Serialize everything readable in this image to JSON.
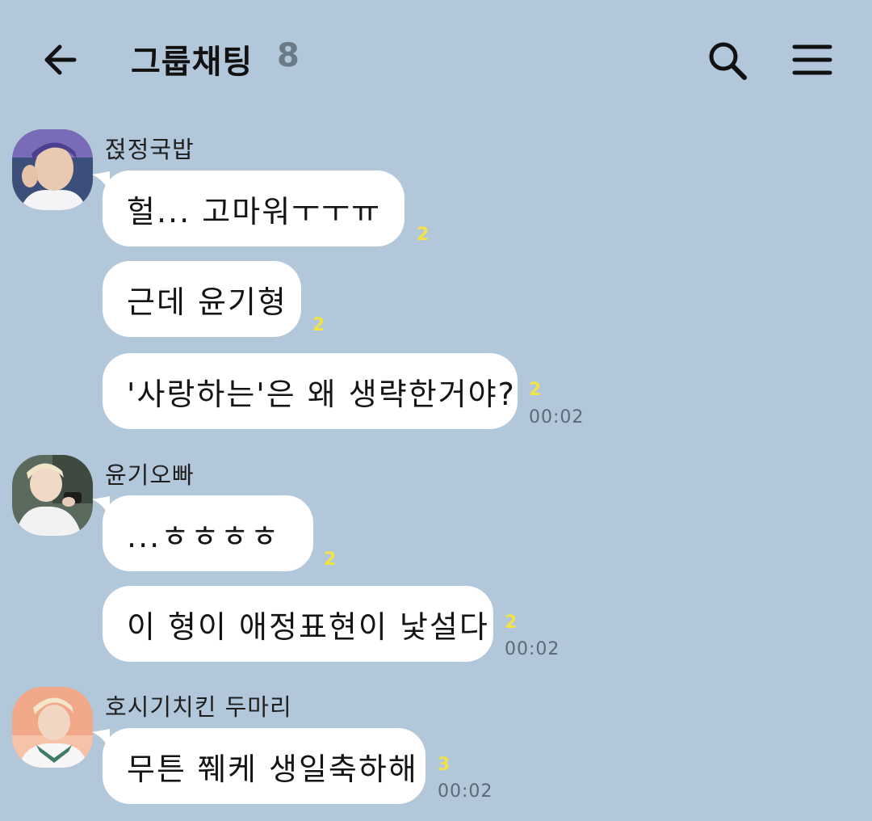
{
  "header": {
    "title": "그룹채팅",
    "member_count": "8"
  },
  "messages": [
    {
      "sender": "젅정국밥",
      "avatar": "avatar-jungkook",
      "lines": [
        {
          "text": "헐... 고마워ㅜㅜㅠ",
          "unread": "2",
          "time": ""
        },
        {
          "text": "근데 윤기형",
          "unread": "2",
          "time": ""
        },
        {
          "text": "'사랑하는'은 왜 생략한거야?",
          "unread": "2",
          "time": "00:02"
        }
      ]
    },
    {
      "sender": "윤기오빠",
      "avatar": "avatar-yoongi",
      "lines": [
        {
          "text": "...ㅎㅎㅎㅎ",
          "unread": "2",
          "time": ""
        },
        {
          "text": "이 형이 애정표현이 낯설다",
          "unread": "2",
          "time": "00:02"
        }
      ]
    },
    {
      "sender": "호시기치킨 두마리",
      "avatar": "avatar-hoseok",
      "lines": [
        {
          "text": "무튼 쮀케 생일축하해",
          "unread": "3",
          "time": "00:02"
        }
      ]
    }
  ],
  "colors": {
    "background": "#b2c7d9",
    "bubble": "#ffffff",
    "unread": "#f2e24a",
    "time": "#5d6a75",
    "member_count": "#6b7a87"
  }
}
